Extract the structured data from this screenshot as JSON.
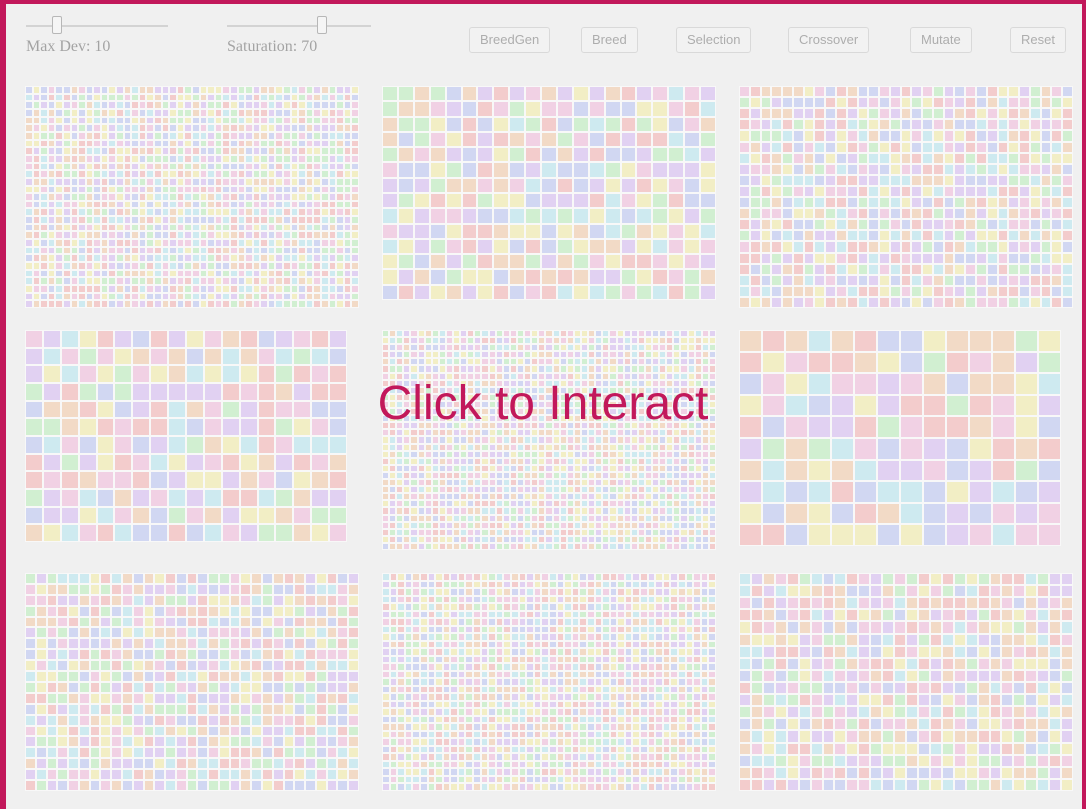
{
  "controls": {
    "max_dev": {
      "label": "Max Dev: 10",
      "value": 10
    },
    "saturation": {
      "label": "Saturation: 70",
      "value": 70
    }
  },
  "buttons": {
    "breedgen": "BreedGen",
    "breed": "Breed",
    "selection": "Selection",
    "crossover": "Crossover",
    "mutate": "Mutate",
    "reset": "Reset"
  },
  "palette": [
    "#f6b0b0",
    "#f4c9a4",
    "#f5eea2",
    "#b9efb9",
    "#b4e6f0",
    "#b9c3f5",
    "#d6b8f4",
    "#f2b8dc"
  ],
  "overlay": {
    "text": "Click to Interact"
  }
}
